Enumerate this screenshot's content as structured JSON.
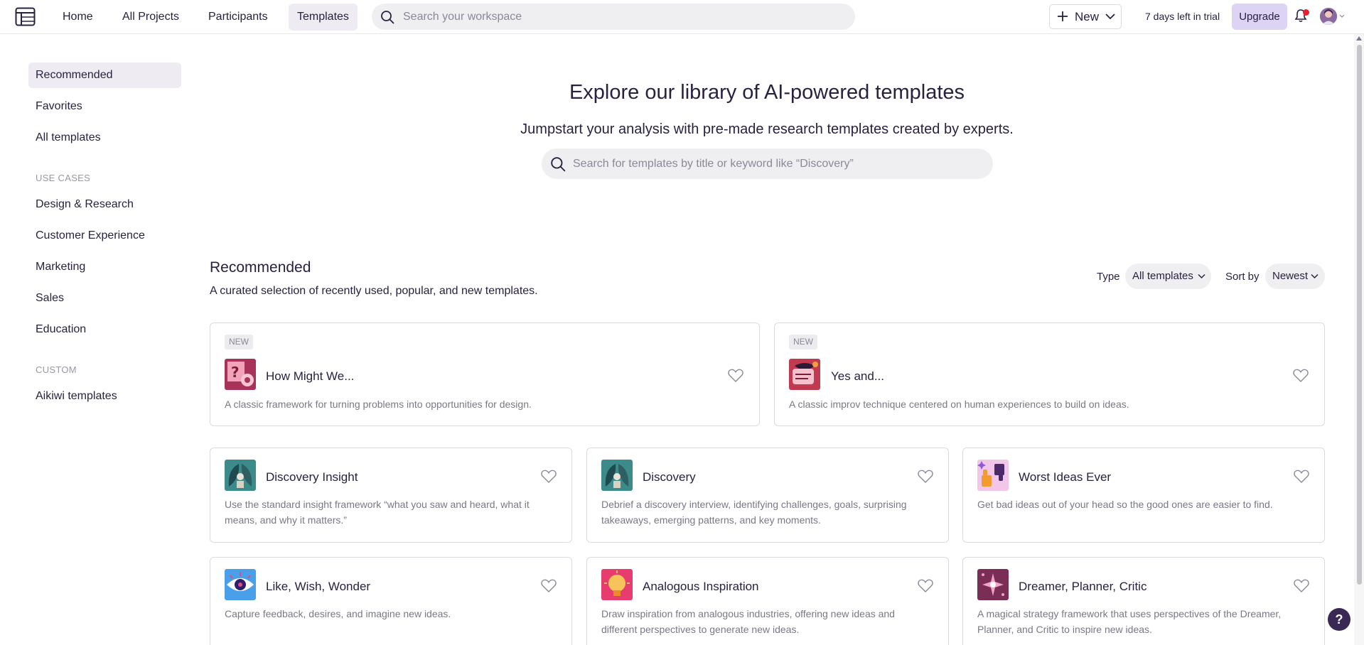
{
  "topbar": {
    "nav": [
      "Home",
      "All Projects",
      "Participants",
      "Templates"
    ],
    "search_placeholder": "Search your workspace",
    "new_label": "New",
    "trial_text": "7 days left in trial",
    "upgrade_label": "Upgrade"
  },
  "sidebar": {
    "items_top": [
      "Recommended",
      "Favorites",
      "All templates"
    ],
    "use_cases_heading": "USE CASES",
    "use_cases": [
      "Design & Research",
      "Customer Experience",
      "Marketing",
      "Sales",
      "Education"
    ],
    "custom_heading": "CUSTOM",
    "custom": [
      "Aikiwi templates"
    ]
  },
  "hero": {
    "title": "Explore our library of AI-powered templates",
    "subtitle": "Jumpstart your analysis with pre-made research templates created by experts.",
    "search_placeholder": "Search for templates by title or keyword like “Discovery”"
  },
  "section": {
    "title": "Recommended",
    "subtitle": "A curated selection of recently used, popular, and new templates.",
    "type_label": "Type",
    "type_value": "All templates",
    "sort_label": "Sort by",
    "sort_value": "Newest"
  },
  "cards": [
    {
      "badge": "NEW",
      "title": "How Might We...",
      "desc": "A classic framework for turning problems into opportunities for design.",
      "icon": "question-mark-icon"
    },
    {
      "badge": "NEW",
      "title": "Yes and...",
      "desc": "A classic improv technique centered on human experiences to build on ideas.",
      "icon": "speech-icon"
    },
    {
      "title": "Discovery Insight",
      "desc": "Use the standard insight framework “what you saw and heard, what it means, and why it matters.”",
      "icon": "leaves-icon"
    },
    {
      "title": "Discovery",
      "desc": "Debrief a discovery interview, identifying challenges, goals, surprising takeaways, emerging patterns, and key moments.",
      "icon": "leaves-icon"
    },
    {
      "title": "Worst Ideas Ever",
      "desc": "Get bad ideas out of your head so the good ones are easier to find.",
      "icon": "thumbs-icon"
    },
    {
      "title": "Like, Wish, Wonder",
      "desc": "Capture feedback, desires, and imagine new ideas.",
      "icon": "eye-icon"
    },
    {
      "title": "Analogous Inspiration",
      "desc": "Draw inspiration from analogous industries, offering new ideas and different perspectives to generate new ideas.",
      "icon": "lightbulb-icon"
    },
    {
      "title": "Dreamer, Planner, Critic",
      "desc": "A magical strategy framework that uses perspectives of the Dreamer, Planner, and Critic to inspire new ideas.",
      "icon": "sparkle-icon"
    }
  ],
  "help_label": "?"
}
